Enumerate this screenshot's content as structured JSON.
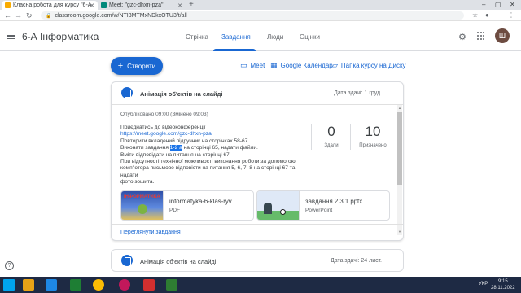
{
  "browser": {
    "tabs": [
      {
        "title": "Класна робота для курсу \"6-А І"
      },
      {
        "title": "Meet: \"gzc-dhxn-pza\""
      }
    ],
    "url": "classroom.google.com/w/NTI3MTMxNDkxOTU3/t/all"
  },
  "app": {
    "class_name": "6-А Інформатика",
    "nav_tabs": [
      "Стрічка",
      "Завдання",
      "Люди",
      "Оцінки"
    ],
    "active_tab_index": 1,
    "avatar_letter": "Ш"
  },
  "toolbar": {
    "create_label": "Створити",
    "meet_label": "Meet",
    "calendar_label": "Google Календар",
    "folder_label": "Папка курсу на Диску"
  },
  "assignment": {
    "title": "Анімація об'єктів на слайді",
    "due": "Дата здачі: 1 груд.",
    "published": "Опубліковано 09:00 (Змінено 09:03)",
    "desc_lines": [
      "Приєднатись до відеоконференції",
      "https://meet.google.com/gzc-dhxn-pza",
      "Повторити вкладений підручник на сторінках 58-67.",
      "Виконати завдання",
      "1-2 а",
      " на сторінці 65, надати файли.",
      "Вміти відповідати на питання на сторінці 67.",
      "При відсутності технічної можливості виконання роботи за допомогою",
      "комп'ютера письмово відповісти на питання 5, 6, 7, 8 на сторінці 67 та надати",
      "фото зошита."
    ],
    "stats": [
      {
        "value": "0",
        "label": "Здали"
      },
      {
        "value": "10",
        "label": "Призначено"
      }
    ],
    "attachments": [
      {
        "name": "informatyka-6-klas-ryv...",
        "type": "PDF",
        "thumb_text": "ІНФОРМАТИКА"
      },
      {
        "name": "завдання 2.3.1.pptx",
        "type": "PowerPoint"
      }
    ],
    "view_label": "Переглянути завдання"
  },
  "assignment2": {
    "title": "Анімація об'єктів на слайді.",
    "due": "Дата здачі: 24 лист."
  },
  "taskbar": {
    "lang": "УКР",
    "time": "9:15",
    "date": "28.11.2022"
  }
}
